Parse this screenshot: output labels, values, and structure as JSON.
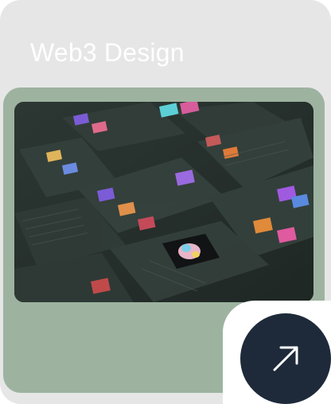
{
  "card": {
    "title": "Web3 Design",
    "action_icon": "arrow-up-right-icon",
    "colors": {
      "card_background": "#e6e6e6",
      "panel_green": "#9db3a0",
      "button_navy": "#1e2a3a",
      "title_text": "#ffffff"
    }
  }
}
